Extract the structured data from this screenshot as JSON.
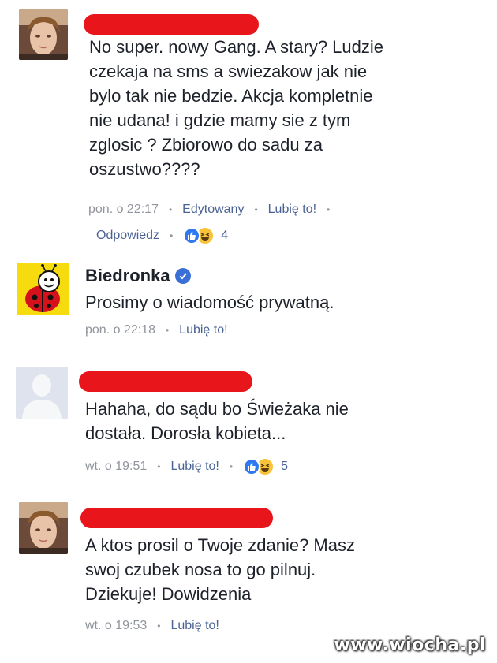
{
  "comments": [
    {
      "author_redacted": true,
      "text": "No super. nowy Gang. A stary? Ludzie\nczekaja na sms a swiezakow jak nie\nbylo tak nie bedzie. Akcja kompletnie\nnie udana! i gdzie mamy sie z tym\nzglosic ? Zbiorowo do sadu za\noszustwo????",
      "time": "pon. o 22:17",
      "edited": "Edytowany",
      "like": "Lubię to!",
      "reply": "Odpowiedz",
      "reaction_count": "4"
    },
    {
      "author": "Biedronka",
      "verified": true,
      "text": "Prosimy o wiadomość prywatną.",
      "time": "pon. o 22:18",
      "like": "Lubię to!"
    },
    {
      "author_redacted": true,
      "text": "Hahaha, do sądu bo Świeżaka nie\ndostała. Dorosła kobieta...",
      "time": "wt. o 19:51",
      "like": "Lubię to!",
      "reaction_count": "5"
    },
    {
      "author_redacted": true,
      "text": "A ktos prosil o Twoje zdanie? Masz\nswoj czubek nosa to go pilnuj.\nDziekuje! Dowidzenia",
      "time": "wt. o 19:53",
      "like": "Lubię to!"
    }
  ],
  "watermark": "www.wiocha.pl",
  "colors": {
    "redaction": "#e8161b",
    "link": "#4b6394",
    "meta": "#90949c",
    "like_reaction": "#2f78f0",
    "haha_reaction": "#f7c33a"
  }
}
